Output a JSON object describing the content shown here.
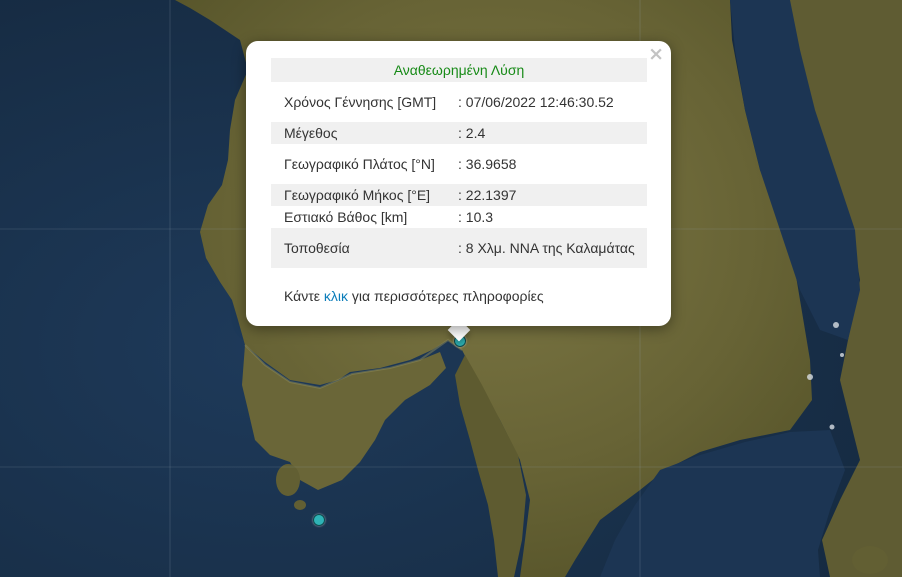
{
  "popup": {
    "title": "Αναθεωρημένη Λύση",
    "rows": [
      {
        "label": "Χρόνος Γέννησης [GMT]",
        "value": ": 07/06/2022 12:46:30.52"
      },
      {
        "label": "Μέγεθος",
        "value": ": 2.4"
      },
      {
        "label": "Γεωγραφικό Πλάτος [°N]",
        "value": ": 36.9658"
      },
      {
        "label": "Γεωγραφικό Μήκος [°E]",
        "value": ": 22.1397"
      },
      {
        "label": "Εστιακό Βάθος [km]",
        "value": ": 10.3"
      },
      {
        "label": "Τοποθεσία",
        "value": ": 8 Χλμ. ΝΝΑ της Καλαμάτας"
      }
    ],
    "footer_before": "Κάντε ",
    "footer_link": "κλικ",
    "footer_after": " για περισσότερες πληροφορίες",
    "close_symbol": "×"
  },
  "colors": {
    "sea": "#1b3350",
    "land": "#6d6a3e",
    "marker": "#2fb3b6",
    "title_green": "#178a17",
    "link_blue": "#0b7dba"
  }
}
